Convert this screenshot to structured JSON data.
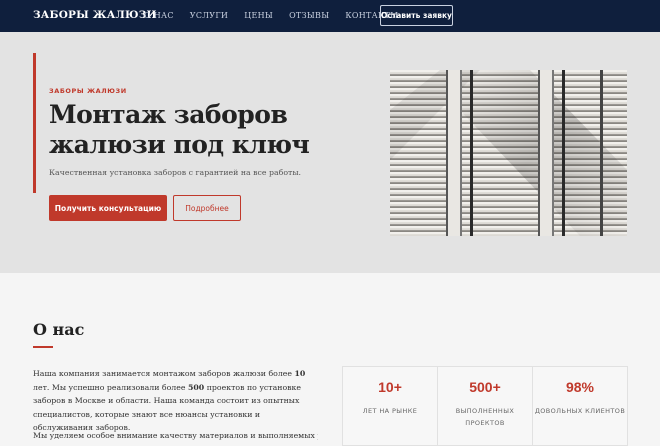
{
  "nav": {
    "brand": "ЗАБОРЫ ЖАЛЮЗИ",
    "links": [
      "О НАС",
      "УСЛУГИ",
      "ЦЕНЫ",
      "ОТЗЫВЫ",
      "КОНТАКТЫ"
    ],
    "cta": "Оставить заявку"
  },
  "hero": {
    "kicker": "ЗАБОРЫ ЖАЛЮЗИ",
    "title": "Монтаж заборов жалюзи под ключ",
    "subtitle": "Качественная установка заборов с гарантией на все работы.",
    "primary_button": "Получить консультацию",
    "secondary_button": "Подробнее"
  },
  "about": {
    "title": "О нас",
    "p1_parts": [
      "Наша компания занимается монтажом заборов жалюзи более ",
      "10",
      " лет. Мы успешно реализовали более ",
      "500",
      " проектов по установке заборов в Москве и области. Наша команда состоит из опытных специалистов, которые знают все нюансы установки и обслуживания заборов."
    ],
    "p2": "Мы уделяем особое внимание качеству материалов и выполняемых работ. Наша",
    "stats": [
      {
        "value": "10+",
        "label": "ЛЕТ НА РЫНКЕ"
      },
      {
        "value": "500+",
        "label": "ВЫПОЛНЕННЫХ ПРОЕКТОВ"
      },
      {
        "value": "98%",
        "label": "ДОВОЛЬНЫХ КЛИЕНТОВ"
      }
    ]
  },
  "colors": {
    "nav_bg": "#0f1f3d",
    "accent": "#c0392b",
    "hero_bg": "#e3e3e3"
  }
}
